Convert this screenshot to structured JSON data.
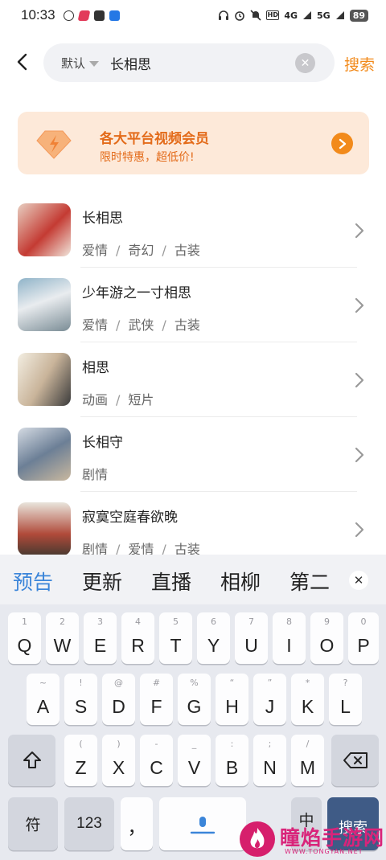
{
  "status_bar": {
    "time": "10:33",
    "notifications": [
      "k-app-icon",
      "red-app-icon",
      "mail-icon",
      "blue-app-icon"
    ],
    "indicators": [
      "headphones-icon",
      "alarm-icon",
      "mute-icon",
      "HD",
      "4G",
      "5G"
    ],
    "battery": "89"
  },
  "search": {
    "filter_label": "默认",
    "query": "长相思",
    "button_label": "搜索"
  },
  "banner": {
    "title": "各大平台视频会员",
    "subtitle": "限时特惠，超低价!"
  },
  "results": [
    {
      "title": "长相思",
      "tags": [
        "爱情",
        "奇幻",
        "古装"
      ]
    },
    {
      "title": "少年游之一寸相思",
      "tags": [
        "爱情",
        "武侠",
        "古装"
      ]
    },
    {
      "title": "相思",
      "tags": [
        "动画",
        "短片"
      ]
    },
    {
      "title": "长相守",
      "tags": [
        "剧情"
      ]
    },
    {
      "title": "寂寞空庭春欲晚",
      "tags": [
        "剧情",
        "爱情",
        "古装"
      ]
    }
  ],
  "keyboard": {
    "candidates": [
      "预告",
      "更新",
      "直播",
      "相柳",
      "第二"
    ],
    "row1": [
      {
        "key": "Q",
        "hint": "1"
      },
      {
        "key": "W",
        "hint": "2"
      },
      {
        "key": "E",
        "hint": "3"
      },
      {
        "key": "R",
        "hint": "4"
      },
      {
        "key": "T",
        "hint": "5"
      },
      {
        "key": "Y",
        "hint": "6"
      },
      {
        "key": "U",
        "hint": "7"
      },
      {
        "key": "I",
        "hint": "8"
      },
      {
        "key": "O",
        "hint": "9"
      },
      {
        "key": "P",
        "hint": "0"
      }
    ],
    "row2": [
      {
        "key": "A",
        "hint": "~"
      },
      {
        "key": "S",
        "hint": "!"
      },
      {
        "key": "D",
        "hint": "@"
      },
      {
        "key": "F",
        "hint": "#"
      },
      {
        "key": "G",
        "hint": "%"
      },
      {
        "key": "H",
        "hint": "“"
      },
      {
        "key": "J",
        "hint": "”"
      },
      {
        "key": "K",
        "hint": "*"
      },
      {
        "key": "L",
        "hint": "?"
      }
    ],
    "row3": [
      {
        "key": "Z",
        "hint": "("
      },
      {
        "key": "X",
        "hint": ")"
      },
      {
        "key": "C",
        "hint": "-"
      },
      {
        "key": "V",
        "hint": "_"
      },
      {
        "key": "B",
        "hint": ":"
      },
      {
        "key": "N",
        "hint": ";"
      },
      {
        "key": "M",
        "hint": "/"
      }
    ],
    "symbol_key": "符",
    "number_key": "123",
    "comma_key": "，",
    "lang_key": "中",
    "search_key": "搜索"
  },
  "watermark": {
    "text": "瞳焰手游网",
    "url": "WWW.TONGYAN.NET"
  },
  "colors": {
    "accent": "#f28a1b",
    "banner_bg": "#fde9d9",
    "candidate_active": "#3b85d9"
  }
}
